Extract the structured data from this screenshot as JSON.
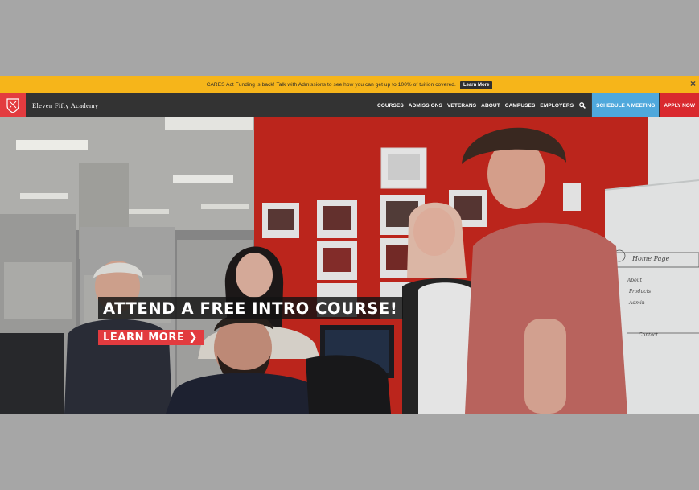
{
  "announcement": {
    "text": "CARES Act Funding is back! Talk with Admissions to see how you can get up to 100% of tuition covered.",
    "button_label": "Learn More",
    "close_glyph": "×"
  },
  "nav": {
    "brand": "Eleven Fifty Academy",
    "links": [
      "COURSES",
      "ADMISSIONS",
      "VETERANS",
      "ABOUT",
      "CAMPUSES",
      "EMPLOYERS"
    ],
    "schedule_label": "SCHEDULE A MEETING",
    "apply_label": "APPLY NOW"
  },
  "hero": {
    "title": "ATTEND A FREE INTRO COURSE!",
    "cta_label": "LEARN MORE",
    "cta_chevron": "❯",
    "whiteboard_text": [
      "Home Page",
      "About",
      "Products",
      "Admin",
      "Contact"
    ]
  },
  "colors": {
    "announce_bg": "#f6b51a",
    "nav_bg": "#333333",
    "logo_red": "#e33b3f",
    "schedule_blue": "#4fa8dc",
    "apply_red": "#d9292e",
    "cta_red": "#e23b3f"
  },
  "icons": {
    "logo": "shield-crest-icon",
    "search": "search-icon",
    "close": "close-icon",
    "chevron": "chevron-right-icon"
  }
}
